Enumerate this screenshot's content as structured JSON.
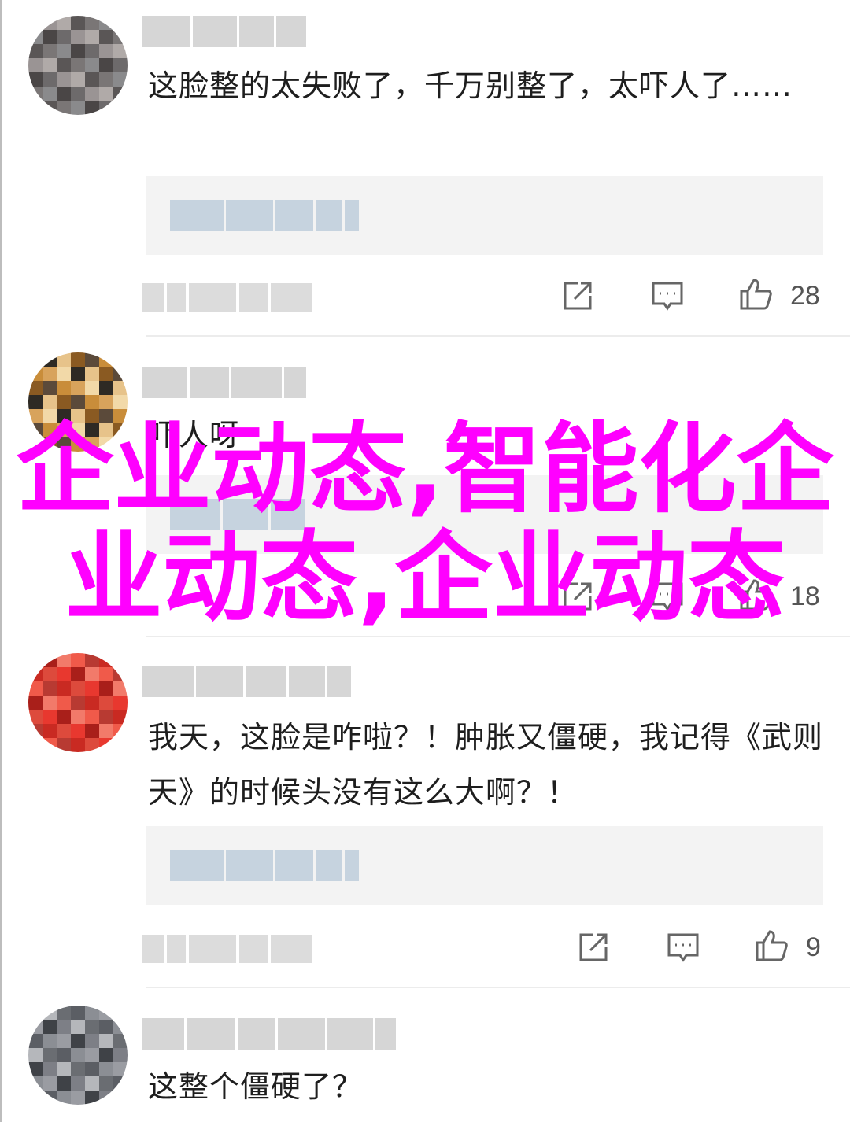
{
  "comments": [
    {
      "text": "这脸整的太失败了，千万别整了，太吓人了……",
      "likes": "28",
      "avatar_colors": [
        "#6d6a6b",
        "#8a8a8c",
        "#5a5656",
        "#9a9494",
        "#4a4646",
        "#7a7676",
        "#b0aaa8"
      ]
    },
    {
      "text": "吓人呀",
      "likes": "18",
      "avatar_colors": [
        "#f2d9a8",
        "#c98d3a",
        "#8a5a22",
        "#2e2a24",
        "#d8a35c",
        "#5b4a3a",
        "#e7c38a"
      ]
    },
    {
      "text": "我天，这脸是咋啦？！肿胀又僵硬，我记得《武则天》的时候头没有这么大啊？！",
      "likes": "9",
      "avatar_colors": [
        "#e8382f",
        "#c92a22",
        "#f05a4a",
        "#a91f1a",
        "#dd4a3c",
        "#b83a32",
        "#f27a6a"
      ]
    },
    {
      "text": "这整个僵硬了？",
      "likes": "",
      "avatar_colors": [
        "#7d7f86",
        "#9a9ca2",
        "#5b5e64",
        "#b5b7bb",
        "#3f4247",
        "#8b8e94",
        "#6a6d72"
      ]
    }
  ],
  "icons": {
    "share": "share-icon",
    "reply": "comment-bubble-icon",
    "like": "thumbs-up-icon"
  },
  "watermark": {
    "text": "企业动态,智能化企业动态,企业动态",
    "color": "#ff00ff"
  }
}
